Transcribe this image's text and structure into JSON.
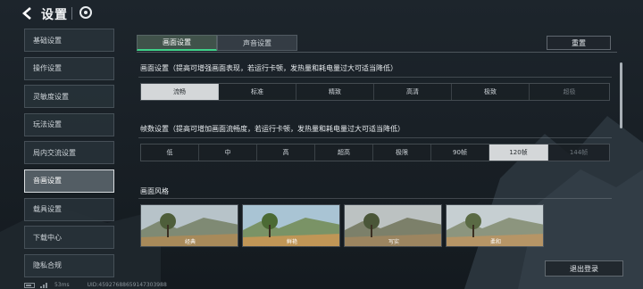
{
  "header": {
    "title": "设置"
  },
  "sidebar": {
    "items": [
      {
        "label": "基础设置",
        "active": false
      },
      {
        "label": "操作设置",
        "active": false
      },
      {
        "label": "灵敏度设置",
        "active": false
      },
      {
        "label": "玩法设置",
        "active": false
      },
      {
        "label": "局内交流设置",
        "active": false
      },
      {
        "label": "音画设置",
        "active": true
      },
      {
        "label": "载具设置",
        "active": false
      },
      {
        "label": "下载中心",
        "active": false
      },
      {
        "label": "隐私合规",
        "active": false
      }
    ]
  },
  "tabs": [
    {
      "label": "画面设置",
      "active": true
    },
    {
      "label": "声音设置",
      "active": false
    }
  ],
  "toolbar": {
    "reset_label": "重置"
  },
  "graphics": {
    "title": "画面设置（提高可增强画面表现，若运行卡顿，发热量和耗电量过大可适当降低）",
    "options": [
      "流畅",
      "标准",
      "精致",
      "高清",
      "极致",
      "超极"
    ],
    "selected": "流畅",
    "disabled": [
      "超极"
    ]
  },
  "framerate": {
    "title": "帧数设置（提高可增加画面流畅度，若运行卡顿，发热量和耗电量过大可适当降低）",
    "options": [
      "低",
      "中",
      "高",
      "超高",
      "极限",
      "90帧",
      "120帧",
      "144帧"
    ],
    "selected": "120帧",
    "disabled": [
      "144帧"
    ]
  },
  "style": {
    "title": "画面风格",
    "cards": [
      {
        "label": "经典"
      },
      {
        "label": "鲜艳"
      },
      {
        "label": "写实"
      },
      {
        "label": "柔和"
      }
    ]
  },
  "footer": {
    "logout_label": "退出登录",
    "latency": "53ms",
    "uid": "UID:4592768865914730398​8"
  },
  "colors": {
    "accent": "#3fd28a",
    "selected_option": "#d4d7d9",
    "background": "#1a2128"
  }
}
